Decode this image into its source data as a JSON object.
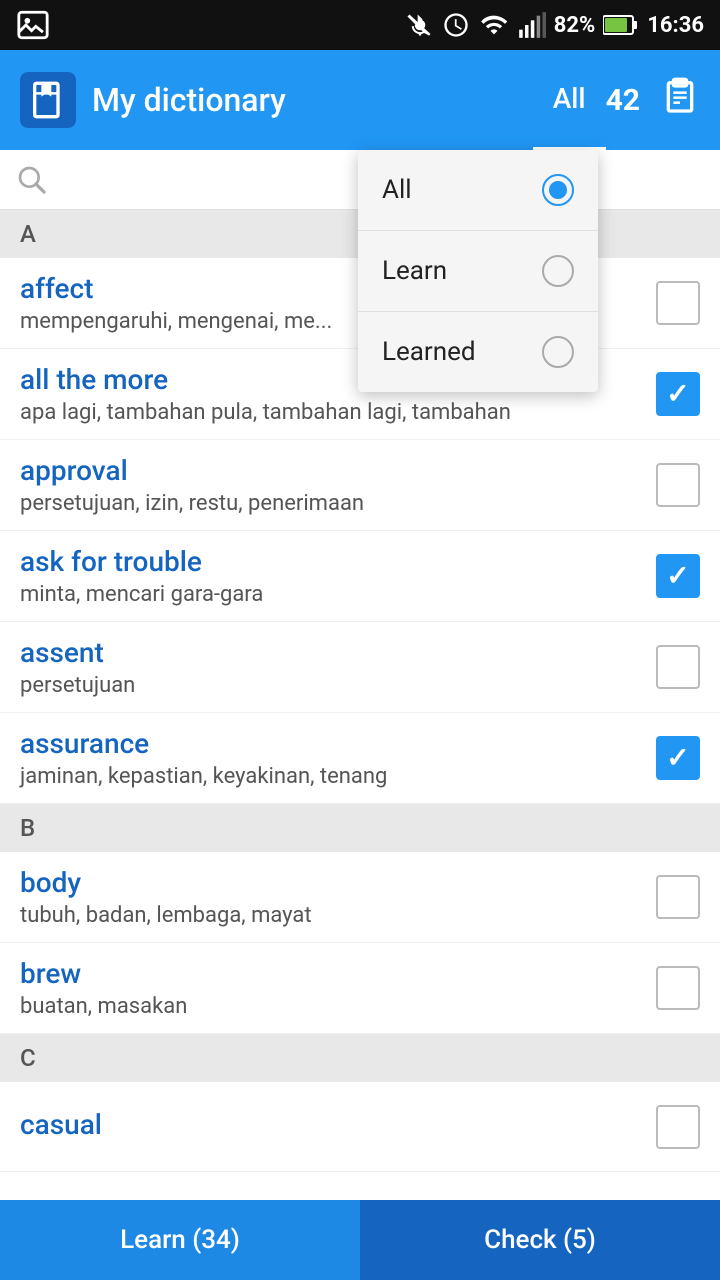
{
  "statusBar": {
    "battery": "82%",
    "time": "16:36"
  },
  "appBar": {
    "title": "My dictionary",
    "filterLabel": "All",
    "count": "42",
    "clipboardIcon": "📋"
  },
  "dropdown": {
    "items": [
      {
        "label": "All",
        "selected": true
      },
      {
        "label": "Learn",
        "selected": false
      },
      {
        "label": "Learned",
        "selected": false
      }
    ]
  },
  "sections": {
    "A": {
      "letter": "A",
      "words": [
        {
          "title": "affect",
          "translation": "mempengaruhi, mengenai, me...",
          "checked": false
        },
        {
          "title": "all the more",
          "translation": "apa lagi, tambahan pula, tambahan lagi, tambahan",
          "checked": true
        },
        {
          "title": "approval",
          "translation": "persetujuan, izin, restu, penerimaan",
          "checked": false
        },
        {
          "title": "ask for trouble",
          "translation": "minta, mencari gara-gara",
          "checked": true
        },
        {
          "title": "assent",
          "translation": "persetujuan",
          "checked": false
        },
        {
          "title": "assurance",
          "translation": "jaminan, kepastian, keyakinan, tenang",
          "checked": true
        }
      ]
    },
    "B": {
      "letter": "B",
      "words": [
        {
          "title": "body",
          "translation": "tubuh, badan, lembaga, mayat",
          "checked": false
        },
        {
          "title": "brew",
          "translation": "buatan, masakan",
          "checked": false
        }
      ]
    },
    "C": {
      "letter": "C",
      "words": [
        {
          "title": "casual",
          "translation": "",
          "checked": false
        }
      ]
    }
  },
  "bottomBar": {
    "learnBtn": "Learn (34)",
    "checkBtn": "Check (5)"
  }
}
